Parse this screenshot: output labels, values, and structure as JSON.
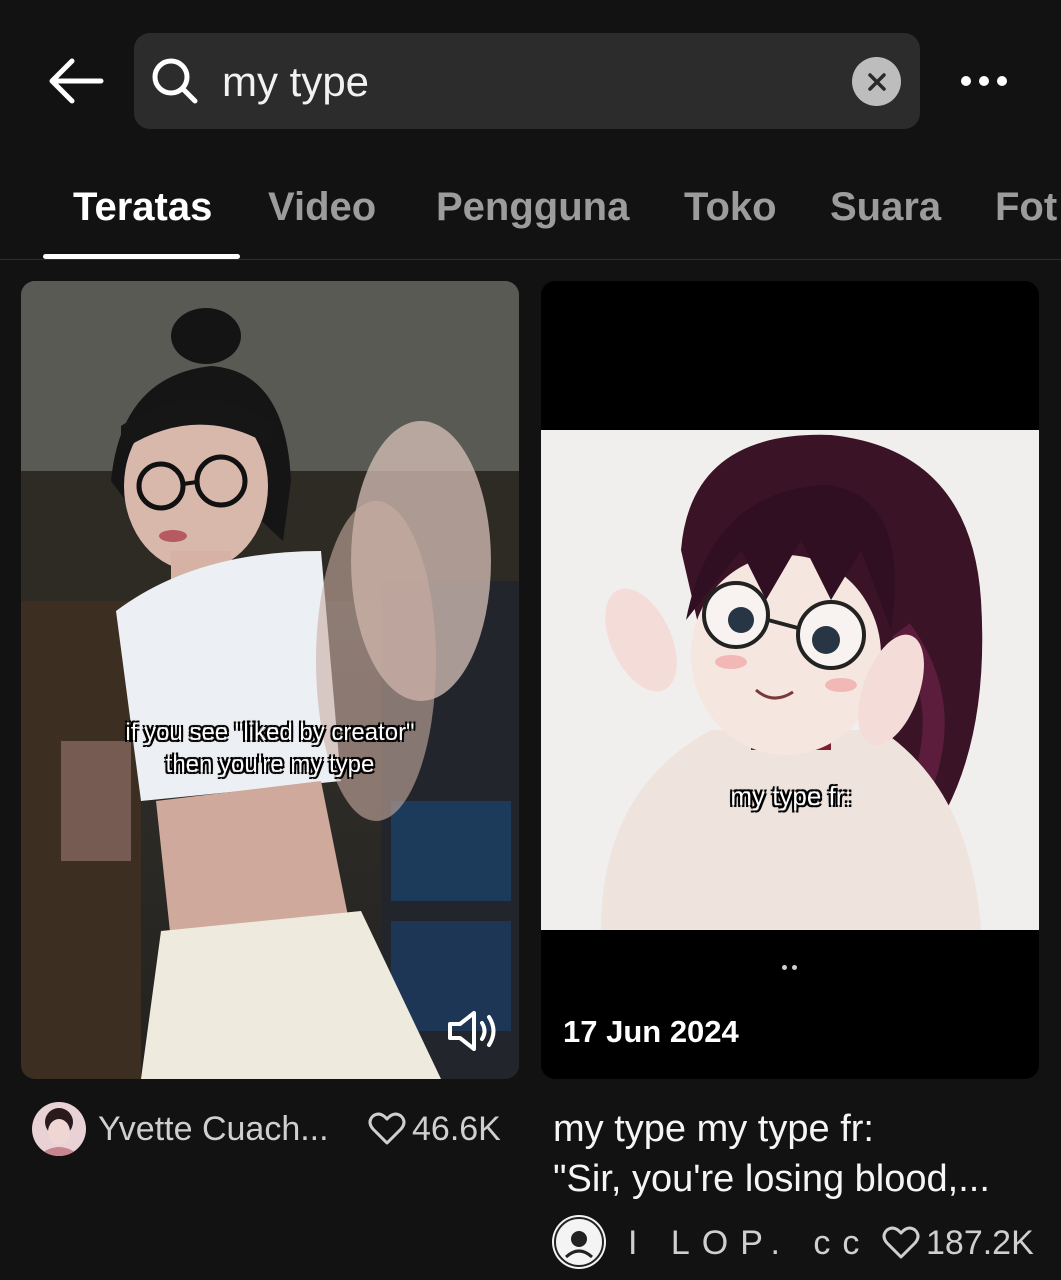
{
  "search": {
    "query": "my type"
  },
  "tabs": [
    {
      "label": "Teratas",
      "active": true
    },
    {
      "label": "Video"
    },
    {
      "label": "Pengguna"
    },
    {
      "label": "Toko"
    },
    {
      "label": "Suara"
    },
    {
      "label": "Fot"
    }
  ],
  "results": [
    {
      "overlay_text_line1": "if you see \"liked by creator\"",
      "overlay_text_line2": "then you're my type",
      "author": "Yvette Cuach...",
      "likes": "46.6K"
    },
    {
      "overlay_text": "my type fr:",
      "date": "17 Jun 2024",
      "description_line1": "my type my type fr:",
      "description_line2": "\"Sir, you're losing blood,...",
      "author": "I LOP. cc",
      "likes": "187.2K"
    }
  ],
  "colors": {
    "background": "#121212",
    "search_box": "#2c2c2c",
    "tab_inactive": "#9c9c9c",
    "tab_active": "#ffffff"
  }
}
